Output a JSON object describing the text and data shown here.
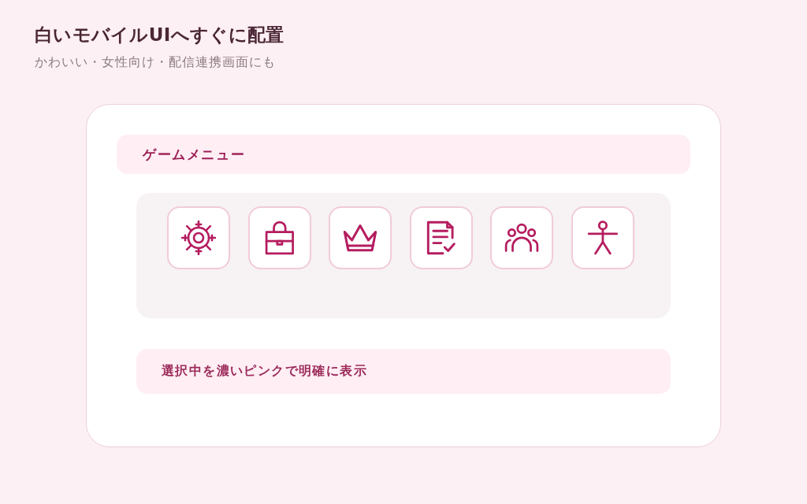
{
  "header": {
    "title": "白いモバイルUIへすぐに配置",
    "subtitle": "かわいい・女性向け・配信連携画面にも"
  },
  "card": {
    "menu_title": "ゲームメニュー",
    "menu_items": [
      {
        "kind": "gear",
        "selected": false
      },
      {
        "kind": "bag",
        "selected": false
      },
      {
        "kind": "crown",
        "selected": false
      },
      {
        "kind": "document",
        "selected": false
      },
      {
        "kind": "people",
        "selected": false
      },
      {
        "kind": "person",
        "selected": false
      }
    ],
    "note": "選択中を濃いピンクで明確に表示"
  }
}
